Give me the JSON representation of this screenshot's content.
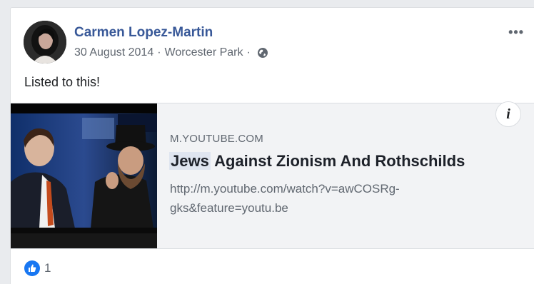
{
  "post": {
    "author": "Carmen Lopez-Martin",
    "date": "30 August 2014",
    "location": "Worcester Park",
    "separator": "·",
    "privacy_icon": "globe-icon",
    "more_label": "•••",
    "text": "Listed to this!"
  },
  "link_preview": {
    "domain": "M.YOUTUBE.COM",
    "title_highlight": "Jews",
    "title_rest": " Against Zionism And Rothschilds",
    "url": "http://m.youtube.com/watch?v=awCOSRg-gks&feature=youtu.be",
    "info_label": "i"
  },
  "reactions": {
    "icon": "like-icon",
    "count": "1"
  },
  "colors": {
    "author": "#385898",
    "like": "#1877f2",
    "card_bg": "#f2f3f5"
  }
}
